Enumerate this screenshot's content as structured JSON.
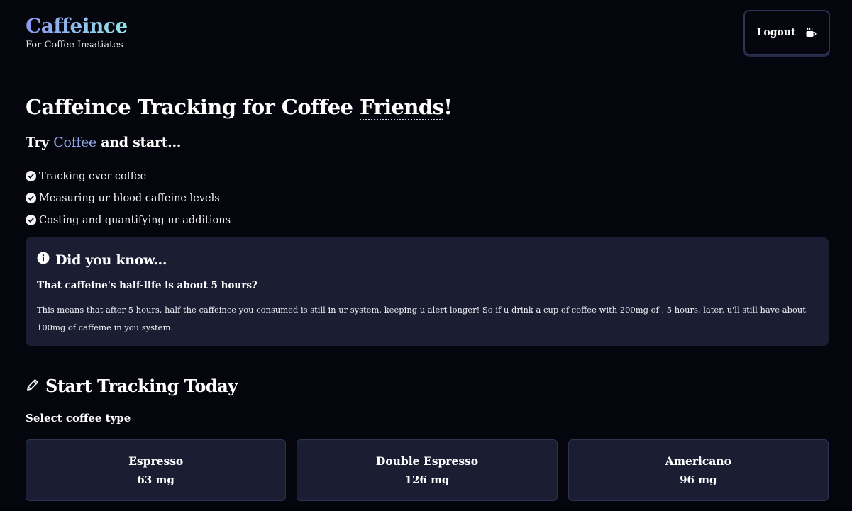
{
  "brand": {
    "title": "Caffeince",
    "subtitle": "For Coffee Insatiates"
  },
  "header": {
    "logout_label": "Logout",
    "logout_icon": "mug-hot-icon"
  },
  "hero": {
    "title_prefix": "Caffeince Tracking for Coffee ",
    "title_emph": "Friends",
    "title_suffix": "!",
    "try_prefix": "Try ",
    "try_accent": "Coffee",
    "try_suffix": " and start...",
    "features": [
      "Tracking ever coffee",
      "Measuring ur blood caffeine levels",
      "Costing and quantifying ur additions"
    ]
  },
  "info": {
    "icon": "info-circle-icon",
    "heading": "Did you know...",
    "question": "That caffeine's half-life is about 5 hours?",
    "body": "This means that after 5 hours, half the caffeince you consumed is still in ur system, keeping u alert longer! So if u drink a cup of coffee with 200mg of , 5 hours, later, u'll still have about 100mg of caffeine in you system."
  },
  "tracking": {
    "icon": "pencil-icon",
    "heading": "Start Tracking Today",
    "select_label": "Select coffee type",
    "coffees": [
      {
        "name": "Espresso",
        "caffeine": "63 mg"
      },
      {
        "name": "Double Espresso",
        "caffeine": "126 mg"
      },
      {
        "name": "Americano",
        "caffeine": "96 mg"
      }
    ]
  },
  "colors": {
    "background": "#05060d",
    "card": "#1b1d33",
    "accent": "#93a9ec",
    "gradient_start": "#8e97f0",
    "gradient_end": "#93e6e9"
  }
}
